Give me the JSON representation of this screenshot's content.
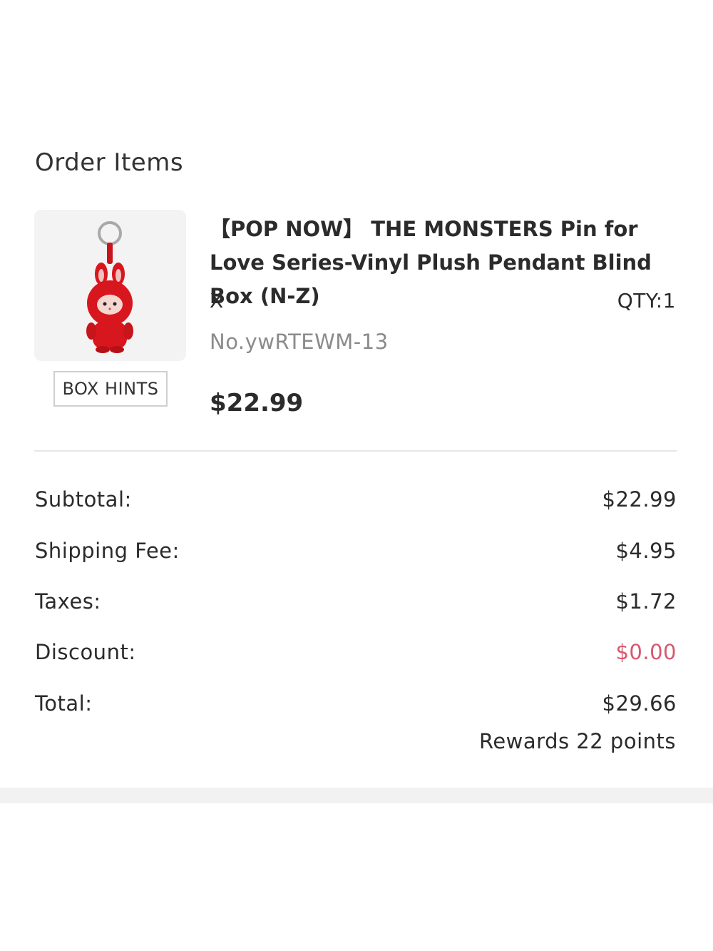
{
  "order": {
    "section_title": "Order Items",
    "item": {
      "title": "【POP NOW】 THE MONSTERS Pin for Love Series-Vinyl Plush Pendant Blind Box (N-Z)",
      "variant": "X",
      "qty": "QTY:1",
      "sku": "No.ywRTEWM-13",
      "price": "$22.99",
      "box_hints_label": "BOX HINTS",
      "image_icon": "red-plush-keychain-icon"
    },
    "summary": [
      {
        "label": "Subtotal:",
        "value": "$22.99"
      },
      {
        "label": "Shipping Fee:",
        "value": "$4.95"
      },
      {
        "label": "Taxes:",
        "value": "$1.72"
      },
      {
        "label": "Discount:",
        "value": "$0.00"
      },
      {
        "label": "Total:",
        "value": "$29.66"
      }
    ],
    "rewards": "Rewards 22 points"
  },
  "colors": {
    "discount": "#d9576f",
    "plush_red": "#d8161d"
  }
}
